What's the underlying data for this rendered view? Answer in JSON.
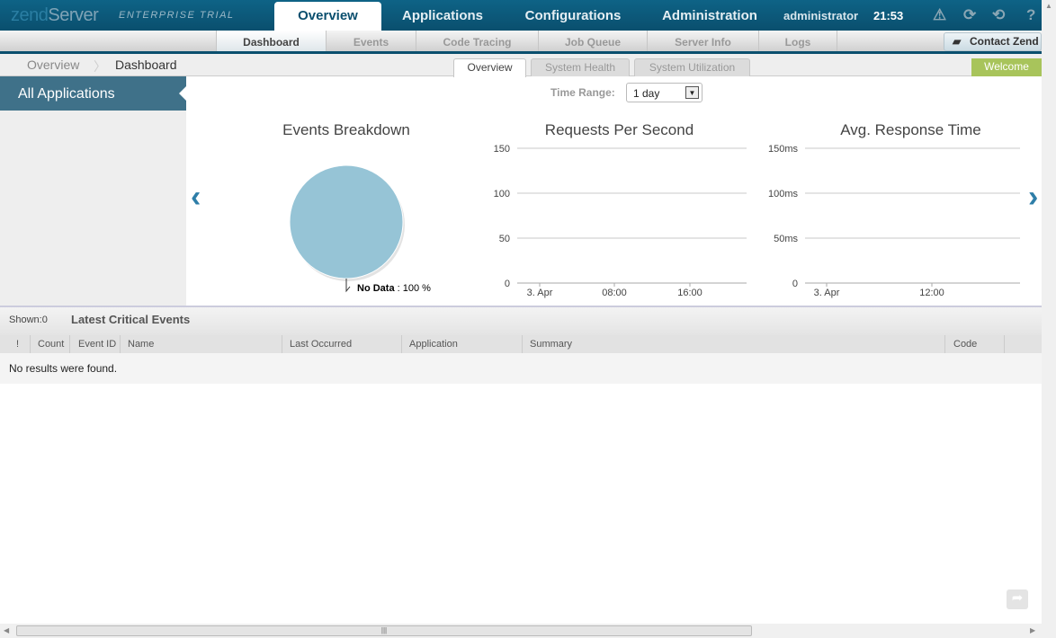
{
  "header": {
    "logo": "zend",
    "logo2": "Server",
    "edition": "ENTERPRISE TRIAL",
    "nav": [
      "Overview",
      "Applications",
      "Configurations",
      "Administration"
    ],
    "active_nav": "Overview",
    "user": "administrator",
    "time": "21:53",
    "icons": [
      "warning-icon",
      "refresh-icon",
      "logout-icon",
      "help-icon"
    ]
  },
  "subnav": {
    "items": [
      "Dashboard",
      "Events",
      "Code Tracing",
      "Job Queue",
      "Server Info",
      "Logs"
    ],
    "active": "Dashboard",
    "contact": "Contact Zend"
  },
  "breadcrumb": [
    "Overview",
    "Dashboard"
  ],
  "tabs": [
    "Overview",
    "System Health",
    "System Utilization"
  ],
  "active_tab": "Overview",
  "welcome": "Welcome",
  "sidebar": {
    "all_apps": "All Applications"
  },
  "time_range": {
    "label": "Time Range:",
    "value": "1 day"
  },
  "chart_data": [
    {
      "type": "pie",
      "title": "Events Breakdown",
      "slices": [
        {
          "label": "No Data",
          "value": 100,
          "display": "100 %",
          "color": "#96c4d6"
        }
      ]
    },
    {
      "type": "line",
      "title": "Requests Per Second",
      "ylim": [
        0,
        150
      ],
      "yticks": [
        "0",
        "50",
        "100",
        "150"
      ],
      "xticks": [
        "3. Apr",
        "08:00",
        "16:00"
      ],
      "series": [],
      "grid": true
    },
    {
      "type": "line",
      "title": "Avg. Response Time",
      "ylim": [
        0,
        150
      ],
      "yticks": [
        "0",
        "50ms",
        "100ms",
        "150ms"
      ],
      "xticks": [
        "3. Apr",
        "12:00"
      ],
      "series": [],
      "grid": true
    }
  ],
  "events": {
    "shown": "Shown:0",
    "title": "Latest Critical Events",
    "columns": [
      "!",
      "Count",
      "Event ID",
      "Name",
      "Last Occurred",
      "Application",
      "Summary",
      "Code Trace"
    ],
    "empty": "No results were found."
  }
}
